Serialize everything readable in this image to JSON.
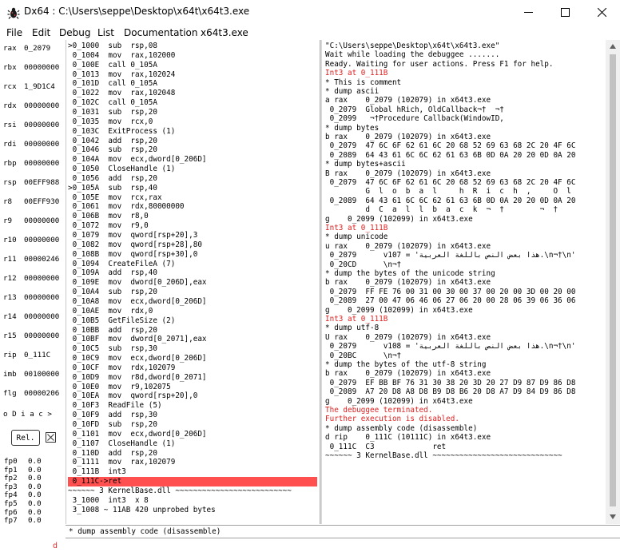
{
  "window": {
    "title": "Dx64 : C:\\Users\\seppe\\Desktop\\x64t\\x64t3.exe"
  },
  "menu": [
    "File",
    "Edit",
    "Debug",
    "List",
    "Documentation",
    "x64t3.exe"
  ],
  "registers": [
    {
      "name": "rax",
      "value": "0_2079"
    },
    {
      "name": "rbx",
      "value": "00000000"
    },
    {
      "name": "rcx",
      "value": "1_9D1C4"
    },
    {
      "name": "rdx",
      "value": "00000000"
    },
    {
      "name": "rsi",
      "value": "00000000"
    },
    {
      "name": "rdi",
      "value": "00000000"
    },
    {
      "name": "rbp",
      "value": "00000000"
    },
    {
      "name": "rsp",
      "value": "00EFF988"
    },
    {
      "name": "r8",
      "value": "00EFF930"
    },
    {
      "name": "r9",
      "value": "00000000"
    },
    {
      "name": "r10",
      "value": "00000000"
    },
    {
      "name": "r11",
      "value": "00000246"
    },
    {
      "name": "r12",
      "value": "00000000"
    },
    {
      "name": "r13",
      "value": "00000000"
    },
    {
      "name": "r14",
      "value": "00000000"
    },
    {
      "name": "r15",
      "value": "00000000"
    },
    {
      "name": "rip",
      "value": "0_111C"
    },
    {
      "name": "imb",
      "value": "00100000"
    },
    {
      "name": "flg",
      "value": "00000206"
    }
  ],
  "flags_text": "o D i a c >",
  "rel_button": "Rel.",
  "fp_registers": [
    {
      "name": "fp0",
      "value": "0.0"
    },
    {
      "name": "fp1",
      "value": "0.0"
    },
    {
      "name": "fp2",
      "value": "0.0"
    },
    {
      "name": "fp3",
      "value": "0.0"
    },
    {
      "name": "fp4",
      "value": "0.0"
    },
    {
      "name": "fp5",
      "value": "0.0"
    },
    {
      "name": "fp6",
      "value": "0.0"
    },
    {
      "name": "fp7",
      "value": "0.0"
    }
  ],
  "d_marker": "d",
  "disassembly": [
    {
      "text": ">0_1000  sub  rsp,08"
    },
    {
      "text": " 0_1004  mov  rax,102000"
    },
    {
      "text": " 0_100E  call 0_105A"
    },
    {
      "text": " 0_1013  mov  rax,102024"
    },
    {
      "text": " 0_101D  call 0_105A"
    },
    {
      "text": " 0_1022  mov  rax,102048"
    },
    {
      "text": " 0_102C  call 0_105A"
    },
    {
      "text": " 0_1031  sub  rsp,20"
    },
    {
      "text": " 0_1035  mov  rcx,0"
    },
    {
      "text": " 0_103C  ExitProcess (1)"
    },
    {
      "text": " 0_1042  add  rsp,20"
    },
    {
      "text": " 0_1046  sub  rsp,20"
    },
    {
      "text": " 0_104A  mov  ecx,dword[0_206D]"
    },
    {
      "text": " 0_1050  CloseHandle (1)"
    },
    {
      "text": " 0_1056  add  rsp,20"
    },
    {
      "text": ">0_105A  sub  rsp,40"
    },
    {
      "text": " 0_105E  mov  rcx,rax"
    },
    {
      "text": " 0_1061  mov  rdx,80000000"
    },
    {
      "text": " 0_106B  mov  r8,0"
    },
    {
      "text": " 0_1072  mov  r9,0"
    },
    {
      "text": " 0_1079  mov  qword[rsp+20],3"
    },
    {
      "text": " 0_1082  mov  qword[rsp+28],80"
    },
    {
      "text": " 0_108B  mov  qword[rsp+30],0"
    },
    {
      "text": " 0_1094  CreateFileA (7)"
    },
    {
      "text": " 0_109A  add  rsp,40"
    },
    {
      "text": " 0_109E  mov  dword[0_206D],eax"
    },
    {
      "text": " 0_10A4  sub  rsp,20"
    },
    {
      "text": " 0_10A8  mov  ecx,dword[0_206D]"
    },
    {
      "text": " 0_10AE  mov  rdx,0"
    },
    {
      "text": " 0_10B5  GetFileSize (2)"
    },
    {
      "text": " 0_10BB  add  rsp,20"
    },
    {
      "text": " 0_10BF  mov  dword[0_2071],eax"
    },
    {
      "text": " 0_10C5  sub  rsp,30"
    },
    {
      "text": " 0_10C9  mov  ecx,dword[0_206D]"
    },
    {
      "text": " 0_10CF  mov  rdx,102079"
    },
    {
      "text": " 0_10D9  mov  r8d,dword[0_2071]"
    },
    {
      "text": " 0_10E0  mov  r9,102075"
    },
    {
      "text": " 0_10EA  mov  qword[rsp+20],0"
    },
    {
      "text": " 0_10F3  ReadFile (5)"
    },
    {
      "text": " 0_10F9  add  rsp,30"
    },
    {
      "text": " 0_10FD  sub  rsp,20"
    },
    {
      "text": " 0_1101  mov  ecx,dword[0_206D]"
    },
    {
      "text": " 0_1107  CloseHandle (1)"
    },
    {
      "text": " 0_110D  add  rsp,20"
    },
    {
      "text": " 0_1111  mov  rax,102079"
    },
    {
      "text": " 0_111B  int3"
    },
    {
      "text": " 0_111C->ret",
      "selected": true
    },
    {
      "text": "~~~~~~ 3 KernelBase.dll ~~~~~~~~~~~~~~~~~~~~~~~~~~"
    },
    {
      "text": " 3_1000  int3  x 8"
    },
    {
      "text": " 3_1008 ~ 11AB 420 unprobed bytes"
    }
  ],
  "log": [
    {
      "text": "\"C:\\Users\\seppe\\Desktop\\x64t\\x64t3.exe\""
    },
    {
      "text": "Wait while loading the debuggee ......."
    },
    {
      "text": "Ready. Waiting for user actions. Press F1 for help."
    },
    {
      "text": "Int3 at 0_111B",
      "red": true
    },
    {
      "text": "* This is comment"
    },
    {
      "text": "* dump ascii"
    },
    {
      "text": "a rax    0_2079 (102079) in x64t3.exe"
    },
    {
      "text": " 0_2079  Global hRich, OldCallback¬†  ¬†"
    },
    {
      "text": " 0_2099   ¬†Procedure Callback(WindowID,"
    },
    {
      "text": "* dump bytes"
    },
    {
      "text": "b rax    0_2079 (102079) in x64t3.exe"
    },
    {
      "text": " 0_2079  47 6C 6F 62 61 6C 20 68 52 69 63 68 2C 20 4F 6C"
    },
    {
      "text": " 0_2089  64 43 61 6C 6C 62 61 63 6B 0D 0A 20 20 0D 0A 20"
    },
    {
      "text": "* dump bytes+ascii"
    },
    {
      "text": "B rax    0_2079 (102079) in x64t3.exe"
    },
    {
      "text": " 0_2079  47 6C 6F 62 61 6C 20 68 52 69 63 68 2C 20 4F 6C"
    },
    {
      "text": "         G  l  o  b  a  l     h  R  i  c  h  ,     O  l"
    },
    {
      "text": " 0_2089  64 43 61 6C 6C 62 61 63 6B 0D 0A 20 20 0D 0A 20"
    },
    {
      "text": "         d  C  a  l  l  b  a  c  k  ¬  †        ¬  †"
    },
    {
      "text": "g    0_2099 (102099) in x64t3.exe"
    },
    {
      "text": "Int3 at 0_111B",
      "red": true
    },
    {
      "text": "* dump unicode"
    },
    {
      "text": "u rax    0_2079 (102079) in x64t3.exe"
    },
    {
      "text": " 0_2079      v107 = 'هذا بعض النص باللغة العربية.\\n¬†\\n'"
    },
    {
      "text": " 0_20CD      \\n¬†"
    },
    {
      "text": "* dump the bytes of the unicode string"
    },
    {
      "text": "b rax    0_2079 (102079) in x64t3.exe"
    },
    {
      "text": " 0_2079  FF FE 76 00 31 00 30 00 37 00 20 00 3D 00 20 00"
    },
    {
      "text": " 0_2089  27 00 47 06 46 06 27 06 20 00 28 06 39 06 36 06"
    },
    {
      "text": "g    0_2099 (102099) in x64t3.exe"
    },
    {
      "text": "Int3 at 0_111B",
      "red": true
    },
    {
      "text": "* dump utf-8"
    },
    {
      "text": "U rax    0_2079 (102079) in x64t3.exe"
    },
    {
      "text": " 0_2079      v108 = 'هذا بعض النص باللغة العربية.\\n¬†\\n'"
    },
    {
      "text": " 0_20BC      \\n¬†"
    },
    {
      "text": "* dump the bytes of the utf-8 string"
    },
    {
      "text": "b rax    0_2079 (102079) in x64t3.exe"
    },
    {
      "text": " 0_2079  EF BB BF 76 31 30 38 20 3D 20 27 D9 87 D9 86 D8"
    },
    {
      "text": " 0_2089  A7 20 D8 A8 D8 B9 D8 B6 20 D8 A7 D9 84 D9 86 D8"
    },
    {
      "text": "g    0_2099 (102099) in x64t3.exe"
    },
    {
      "text": "The debuggee terminated.",
      "red": true
    },
    {
      "text": "Further execution is disabled.",
      "red": true
    },
    {
      "text": "* dump assembly code (disassemble)"
    },
    {
      "text": "d rip    0_111C (10111C) in x64t3.exe"
    },
    {
      "text": " 0_111C  C3             ret"
    },
    {
      "text": "~~~~~~ 3 KernelBase.dll ~~~~~~~~~~~~~~~~~~~~~~~~~~~~~"
    }
  ],
  "command_line": "* dump assembly code (disassemble)"
}
